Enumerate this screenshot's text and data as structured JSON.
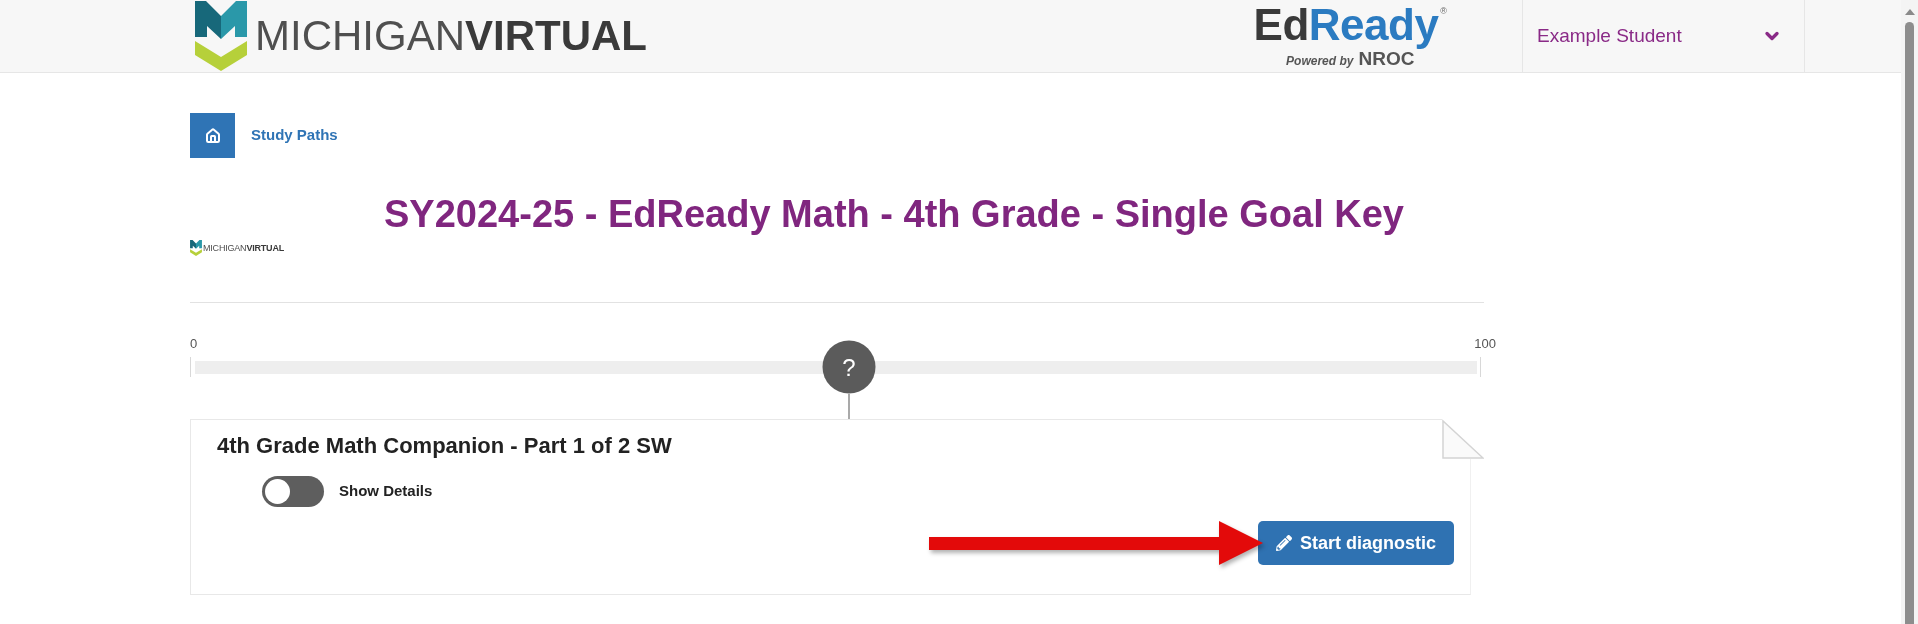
{
  "header": {
    "logo": {
      "parts": [
        {
          "text": "MICHIGAN",
          "kind": "light"
        },
        {
          "text": "VIRTUAL",
          "kind": "bold"
        }
      ]
    },
    "product_logo": {
      "parts": [
        {
          "text": "Ed",
          "kind": "dark"
        },
        {
          "text": "Ready",
          "kind": "accent"
        }
      ],
      "mark": "®",
      "tagline": "Powered by",
      "brand": "NROC"
    },
    "user_menu": {
      "label": "Example Student"
    }
  },
  "breadcrumb": {
    "label": "Study Paths"
  },
  "page_title": "SY2024-25 - EdReady Math - 4th Grade - Single Goal Key",
  "provider_logo": {
    "parts": [
      {
        "text": "MICHIGAN",
        "kind": "light"
      },
      {
        "text": "VIRTUAL",
        "kind": "bold"
      }
    ]
  },
  "score_scale": {
    "min_label": "0",
    "max_label": "100",
    "marker_label": "?",
    "level": 0.51
  },
  "goal_card": {
    "title": "4th Grade Math Companion - Part 1 of 2 SW",
    "details_toggle": {
      "label": "Show Details",
      "on": false
    },
    "action": {
      "label": "Start diagnostic"
    }
  }
}
